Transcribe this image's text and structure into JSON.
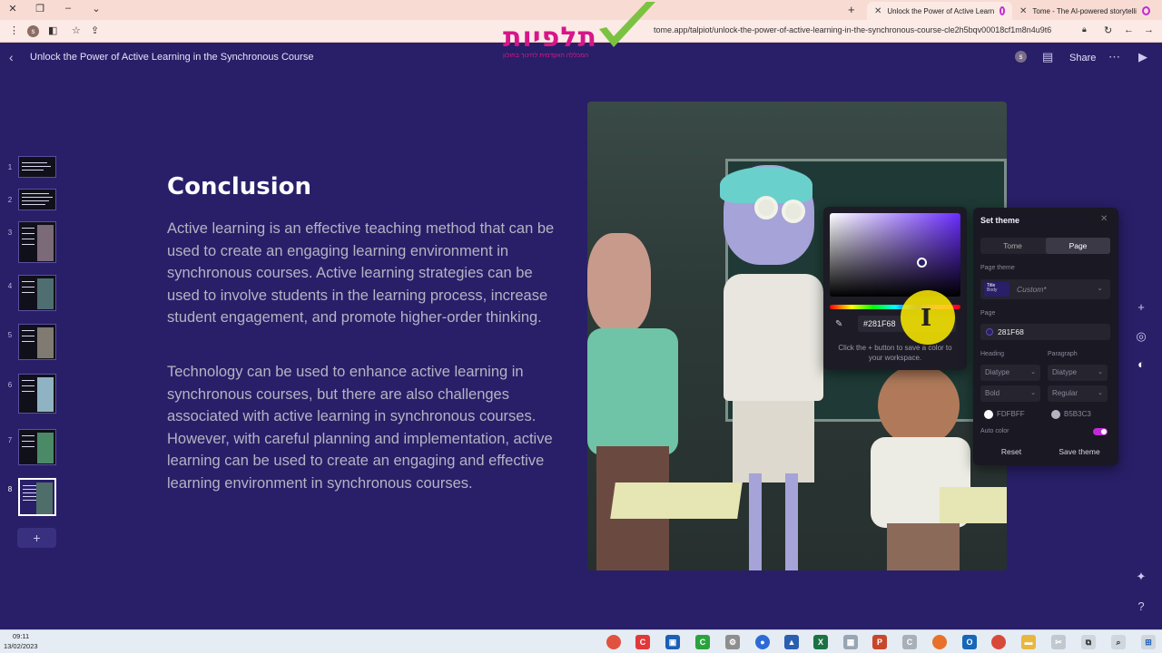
{
  "browser": {
    "tabs": [
      {
        "label": "Unlock the Power of Active Learn",
        "active": true
      },
      {
        "label": "Tome - The AI-powered storytelli",
        "active": false
      }
    ],
    "url": "tome.app/talpiot/unlock-the-power-of-active-learning-in-the-synchronous-course-cle2h5bqv00018cf1m8n4u9t6",
    "profile_initial": "s"
  },
  "logo": {
    "text": "תלפיות",
    "subtitle": "המכללה האקדמית לחינוך בחולון"
  },
  "header": {
    "title": "Unlock the Power of Active Learning in the Synchronous Course",
    "avatar_initial": "s",
    "share_label": "Share"
  },
  "thumbnails": [
    "1",
    "2",
    "3",
    "4",
    "5",
    "6",
    "7",
    "8"
  ],
  "active_slide": "8",
  "add_slide_label": "+",
  "slide": {
    "title": "Conclusion",
    "paragraph1": "Active learning is an effective teaching method that can be used to create an engaging learning environment in synchronous courses. Active learning strategies can be used to involve students in the learning process, increase student engagement, and promote higher-order thinking.",
    "paragraph2": "Technology can be used to enhance active learning in synchronous courses, but there are also challenges associated with active learning in synchronous courses. However, with careful planning and implementation, active learning can be used to create an engaging and effective learning environment in synchronous courses."
  },
  "color_picker": {
    "hex": "#281F68",
    "hint": "Click the + button to save a color to your workspace."
  },
  "theme_panel": {
    "title": "Set theme",
    "tabs": [
      "Tome",
      "Page"
    ],
    "active_tab": "Page",
    "page_theme_label": "Page theme",
    "swatch_title": "Title",
    "swatch_body": "Body",
    "theme_value": "Custom*",
    "page_label": "Page",
    "page_color": "281F68",
    "heading_label": "Heading",
    "paragraph_label": "Paragraph",
    "heading_font": "Diatype",
    "paragraph_font": "Diatype",
    "heading_weight": "Bold",
    "paragraph_weight": "Regular",
    "heading_color": "FDFBFF",
    "paragraph_color": "B5B3C3",
    "auto_color_label": "Auto color",
    "auto_color": true,
    "reset_label": "Reset",
    "save_label": "Save theme"
  },
  "taskbar": {
    "time": "09:11",
    "date": "13/02/2023"
  },
  "colors": {
    "page_bg": "#281F68",
    "heading": "#FDFBFF",
    "paragraph": "#B5B3C3",
    "accent": "#c02bd6"
  }
}
